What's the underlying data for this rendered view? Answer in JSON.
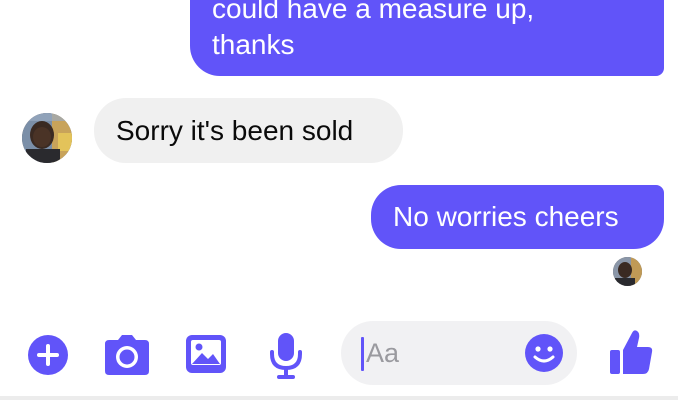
{
  "thread": {
    "messages": [
      {
        "sender": "me",
        "lines": [
          "could have a measure up,",
          "thanks"
        ]
      },
      {
        "sender": "other",
        "lines": [
          "Sorry it's been sold"
        ]
      },
      {
        "sender": "me",
        "lines": [
          "No worries cheers"
        ]
      }
    ]
  },
  "composer": {
    "placeholder": "Aa",
    "value": ""
  },
  "toolbar": {
    "icons": [
      "plus-icon",
      "camera-icon",
      "image-icon",
      "microphone-icon",
      "emoji-icon",
      "thumbs-up-icon"
    ]
  },
  "colors": {
    "accent": "#6154f9",
    "incoming_bubble": "#f0f0f0",
    "composer_bg": "#f1f1f3"
  }
}
